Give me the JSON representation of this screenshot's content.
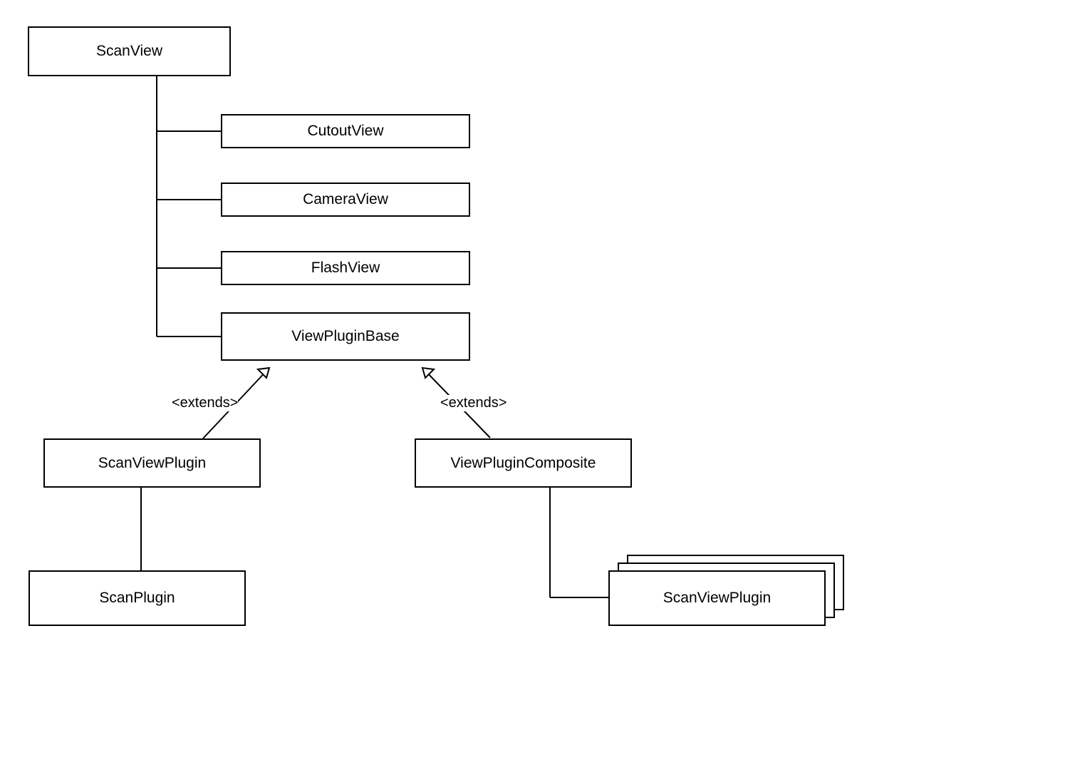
{
  "nodes": {
    "scanView": "ScanView",
    "cutoutView": "CutoutView",
    "cameraView": "CameraView",
    "flashView": "FlashView",
    "viewPluginBase": "ViewPluginBase",
    "scanViewPlugin": "ScanViewPlugin",
    "viewPluginComposite": "ViewPluginComposite",
    "scanPlugin": "ScanPlugin",
    "scanViewPluginMulti": "ScanViewPlugin"
  },
  "relations": {
    "extendsLeft": "<extends>",
    "extendsRight": "<extends>"
  }
}
